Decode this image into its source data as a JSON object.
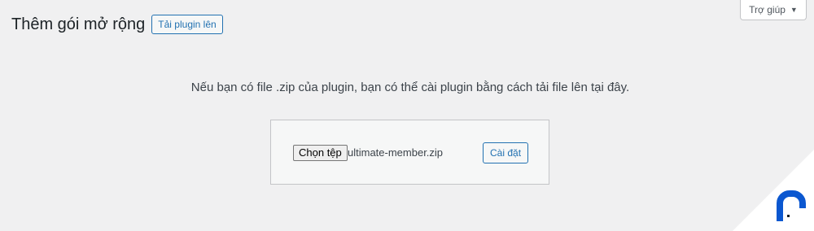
{
  "help": {
    "label": "Trợ giúp",
    "arrow": "▼"
  },
  "header": {
    "title": "Thêm gói mở rộng",
    "upload_button": "Tải plugin lên"
  },
  "upload": {
    "help_text": "Nếu bạn có file .zip của plugin, bạn có thể cài plugin bằng cách tải file lên tại đây.",
    "choose_file_button": "Chọn tệp",
    "file_name": "ultimate-member.zip",
    "install_button": "Cài đặt"
  },
  "colors": {
    "accent": "#2271b1",
    "background": "#f0f0f1",
    "logo": "#0b57d0"
  },
  "icons": {
    "corner_logo": "brand-logo-icon"
  }
}
